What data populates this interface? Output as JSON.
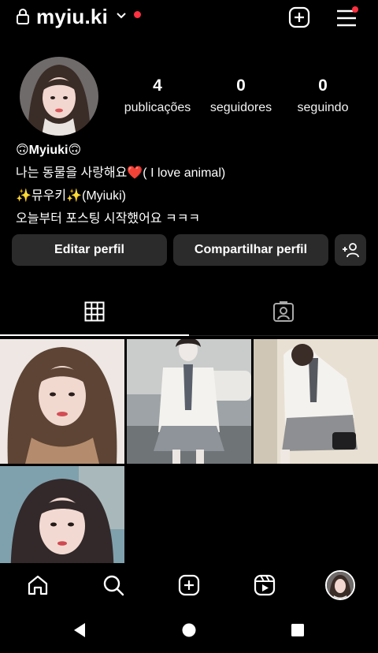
{
  "header": {
    "username": "myiu.ki"
  },
  "stats": [
    {
      "value": "4",
      "label": "publicações"
    },
    {
      "value": "0",
      "label": "seguidores"
    },
    {
      "value": "0",
      "label": "seguindo"
    }
  ],
  "bio": {
    "name": "🙃Myiuki🙃",
    "line1": "나는 동물을 사랑해요❤️( I love animal)",
    "line2": "✨뮤우키✨(Myiuki)",
    "line3": "오늘부터 포스팅 시작했어요 ㅋㅋㅋ"
  },
  "buttons": {
    "edit": "Editar perfil",
    "share": "Compartilhar perfil"
  },
  "colors": {
    "accent_red": "#ff3040",
    "button_bg": "#2b2b2b",
    "background": "#000000"
  },
  "tabs": [
    "grid-icon",
    "tagged-icon"
  ],
  "posts_count": 4
}
